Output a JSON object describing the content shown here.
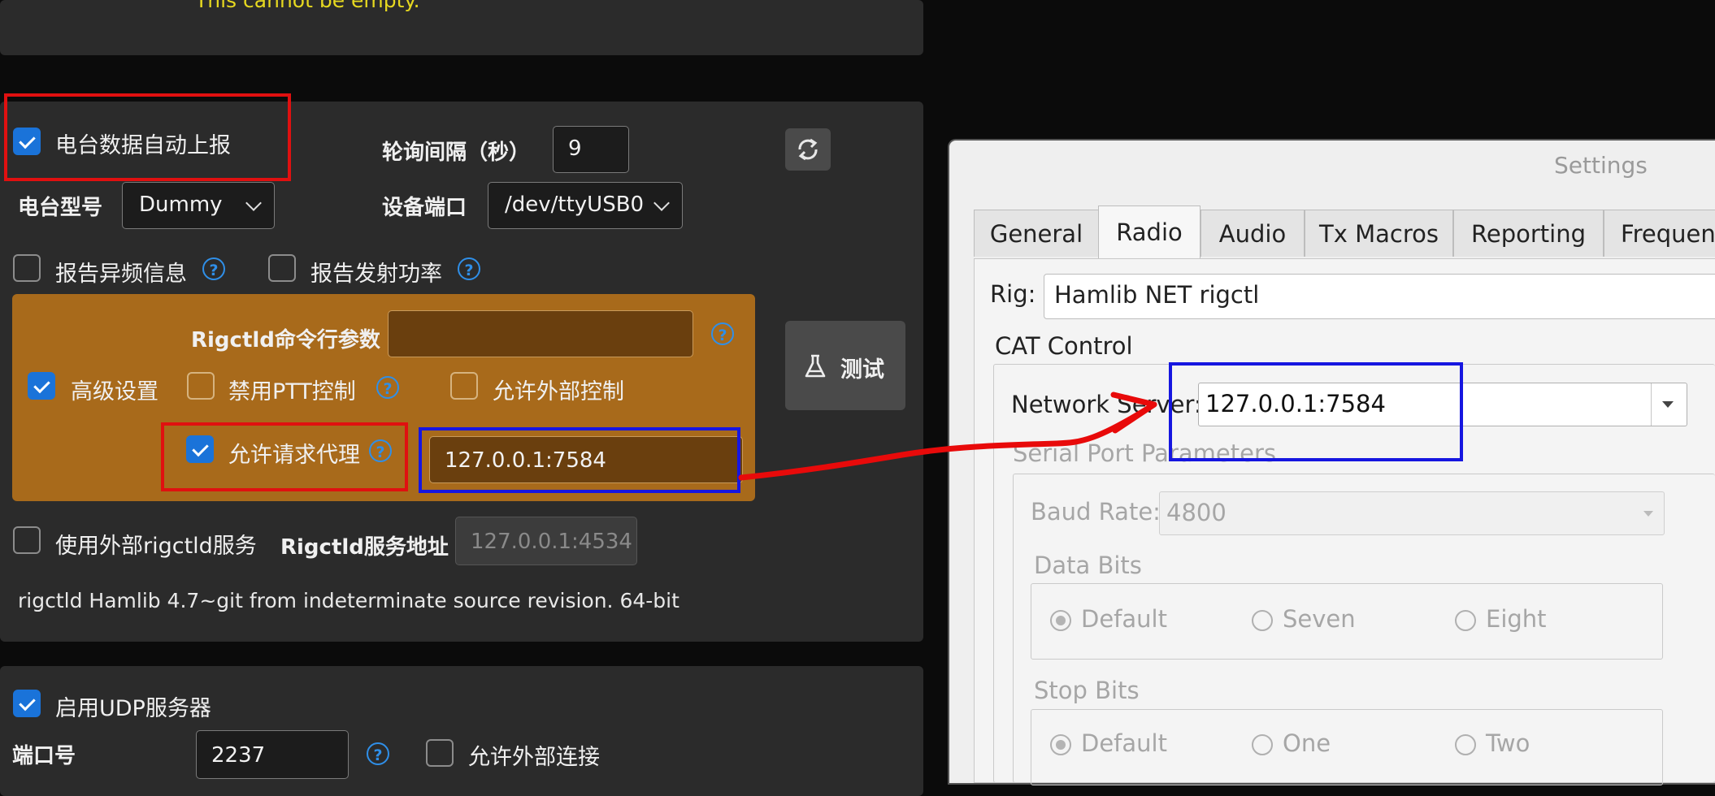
{
  "top_panel": {
    "error_text": "This cannot be empty."
  },
  "radio_panel": {
    "auto_report_label": "电台数据自动上报",
    "poll_interval_label": "轮询间隔（秒）",
    "poll_interval_value": "9",
    "rig_model_label": "电台型号",
    "rig_model_value": "Dummy",
    "device_port_label": "设备端口",
    "device_port_value": "/dev/ttyUSB0",
    "report_split_label": "报告异频信息",
    "report_power_label": "报告发射功率",
    "rigctld_args_label": "Rigctld命令行参数",
    "rigctld_args_value": "",
    "advanced_label": "高级设置",
    "disable_ptt_label": "禁用PTT控制",
    "allow_external_control_label": "允许外部控制",
    "allow_proxy_label": "允许请求代理",
    "proxy_address": "127.0.0.1:7584",
    "test_button_label": "测试",
    "use_external_rigctld_label": "使用外部rigctld服务",
    "rigctld_address_label": "Rigctld服务地址",
    "rigctld_address_value": "127.0.0.1:4534",
    "version_text": "rigctld Hamlib 4.7~git from indeterminate source revision. 64-bit"
  },
  "udp_panel": {
    "enable_udp_label": "启用UDP服务器",
    "port_label": "端口号",
    "port_value": "2237",
    "allow_external_connect_label": "允许外部连接"
  },
  "settings_dialog": {
    "title": "Settings",
    "tabs": [
      {
        "label": "General"
      },
      {
        "label": "Radio"
      },
      {
        "label": "Audio"
      },
      {
        "label": "Tx Macros"
      },
      {
        "label": "Reporting"
      },
      {
        "label": "Frequen"
      }
    ],
    "rig_label": "Rig:",
    "rig_value": "Hamlib NET rigctl",
    "cat_control_label": "CAT Control",
    "network_server_label": "Network Server:",
    "network_server_value": "127.0.0.1:7584",
    "serial_port_params_label": "Serial Port Parameters",
    "baud_rate_label": "Baud Rate:",
    "baud_rate_value": "4800",
    "data_bits_label": "Data Bits",
    "data_bits_options": [
      "Default",
      "Seven",
      "Eight"
    ],
    "stop_bits_label": "Stop Bits",
    "stop_bits_options": [
      "Default",
      "One",
      "Two"
    ]
  },
  "colors": {
    "checkbox_on": "#1a73d9",
    "advanced_bg": "#a86a1b",
    "annotation_red": "#e01010",
    "annotation_blue": "#1616e0",
    "help_icon": "#2f8fe8"
  }
}
